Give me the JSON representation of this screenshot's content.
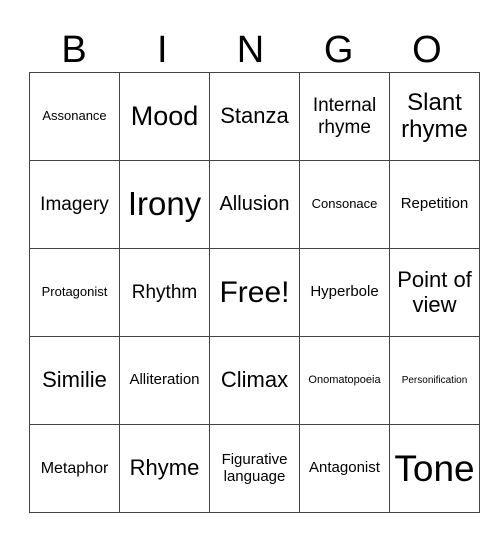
{
  "header": [
    "B",
    "I",
    "N",
    "G",
    "O"
  ],
  "rows": [
    [
      "Assonance",
      "Mood",
      "Stanza",
      "Internal rhyme",
      "Slant rhyme"
    ],
    [
      "Imagery",
      "Irony",
      "Allusion",
      "Consonace",
      "Repetition"
    ],
    [
      "Protagonist",
      "Rhythm",
      "Free!",
      "Hyperbole",
      "Point of view"
    ],
    [
      "Similie",
      "Alliteration",
      "Climax",
      "Onomatopoeia",
      "Personification"
    ],
    [
      "Metaphor",
      "Rhyme",
      "Figurative language",
      "Antagonist",
      "Tone"
    ]
  ]
}
